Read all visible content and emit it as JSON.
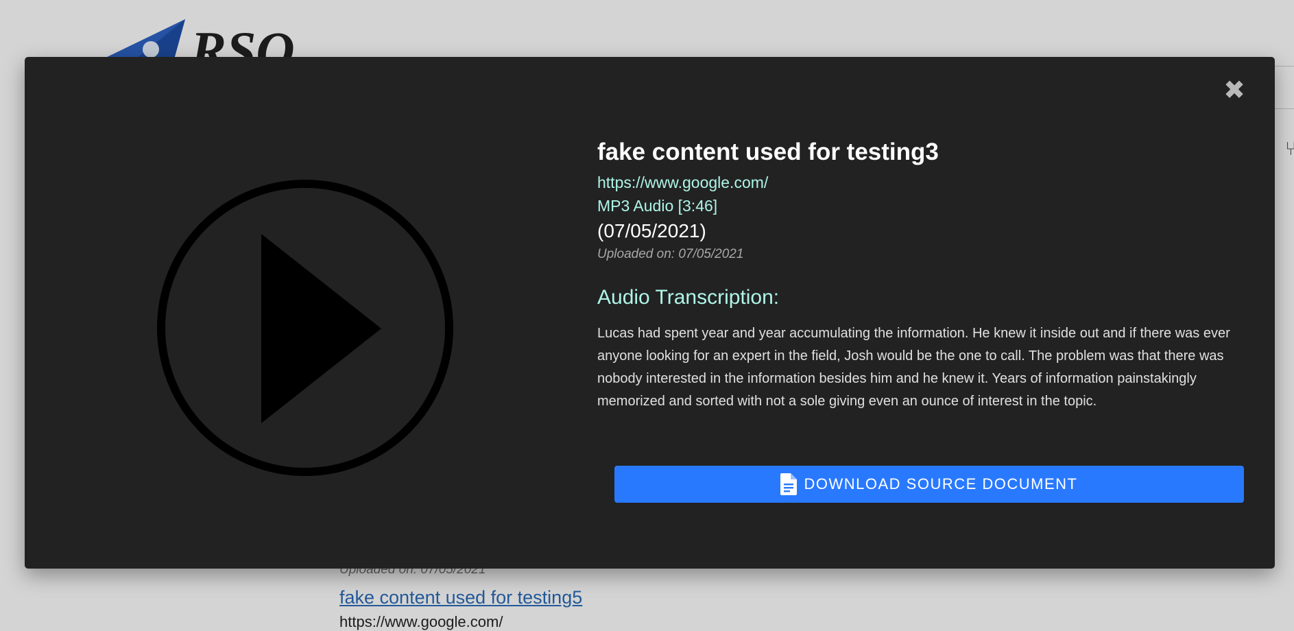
{
  "background": {
    "logo_text": "RSO",
    "item_uploaded": "Uploaded on: 07/05/2021",
    "item_title": "fake content used for testing5",
    "item_url": "https://www.google.com/"
  },
  "modal": {
    "close_icon": "close-icon",
    "play_icon": "play-circle-icon",
    "title": "fake content used for testing3",
    "url": "https://www.google.com/",
    "format": "MP3 Audio [3:46]",
    "date": "(07/05/2021)",
    "uploaded": "Uploaded on: 07/05/2021",
    "transcription_heading": "Audio Transcription:",
    "transcription": "Lucas had spent year and year accumulating the information. He knew it inside out and if there was ever anyone looking for an expert in the field, Josh would be the one to call. The problem was that there was nobody interested in the information besides him and he knew it. Years of information painstakingly memorized and sorted with not a sole giving even an ounce of interest in the topic.",
    "download_icon": "document-icon",
    "download_label": "DOWNLOAD SOURCE DOCUMENT"
  },
  "colors": {
    "modal_bg": "#222222",
    "accent_text": "#aff5e8",
    "button_bg": "#2979ff",
    "link_bg": "#2a6bb8"
  }
}
